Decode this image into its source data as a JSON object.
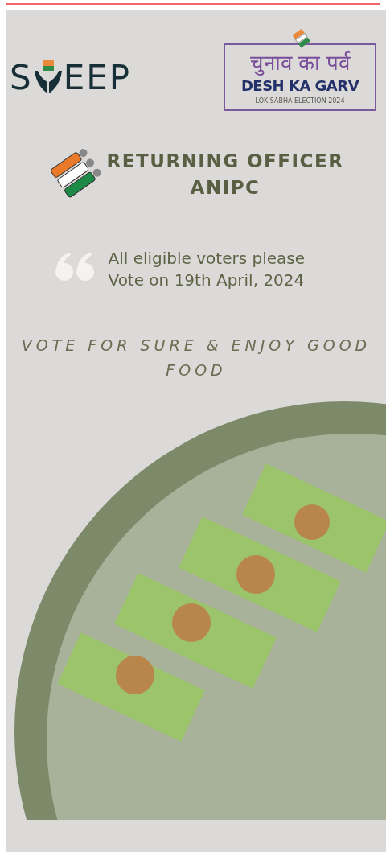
{
  "sweep_logo": {
    "start": "S",
    "end": "EEP"
  },
  "election_logo": {
    "hindi": "चुनाव का पर्व",
    "title": "DESH KA GARV",
    "subtitle": "LOK SABHA ELECTION 2024"
  },
  "officer": {
    "line1": "RETURNING OFFICER",
    "line2": "ANIPC"
  },
  "quote": {
    "text": "All eligible voters please Vote on 19th April, 2024"
  },
  "slogan": "VOTE FOR SURE & ENJOY GOOD FOOD"
}
